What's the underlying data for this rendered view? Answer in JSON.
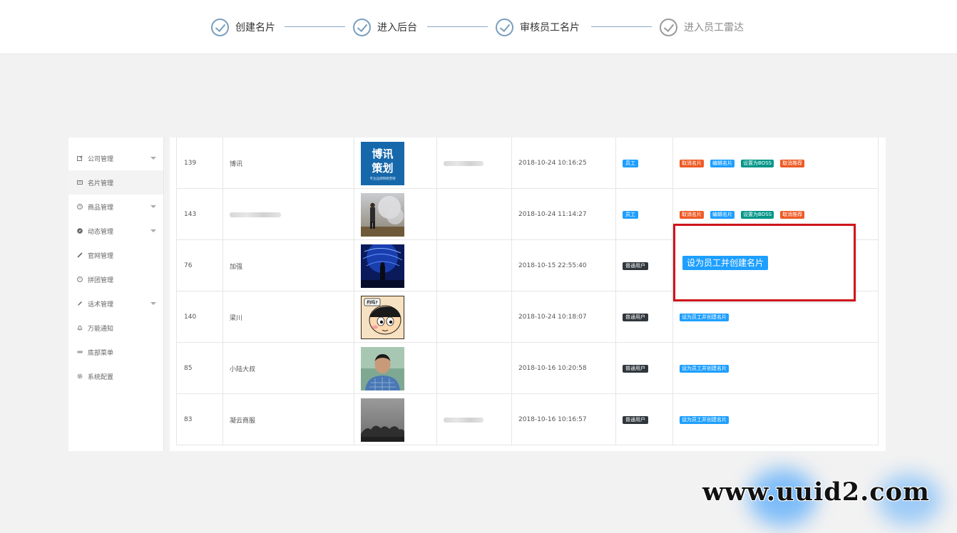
{
  "stepper": {
    "steps": [
      {
        "label": "创建名片",
        "state": "done"
      },
      {
        "label": "进入后台",
        "state": "done"
      },
      {
        "label": "审核员工名片",
        "state": "done"
      },
      {
        "label": "进入员工雷达",
        "state": "pending"
      }
    ]
  },
  "sidebar": {
    "items": [
      {
        "label": "公司管理",
        "icon": "edit-square-icon",
        "expandable": true
      },
      {
        "label": "名片管理",
        "icon": "card-icon",
        "expandable": false,
        "active": true
      },
      {
        "label": "商品管理",
        "icon": "clock-icon",
        "expandable": true
      },
      {
        "label": "动态管理",
        "icon": "compass-icon",
        "expandable": true
      },
      {
        "label": "官网管理",
        "icon": "link-icon",
        "expandable": false
      },
      {
        "label": "拼团管理",
        "icon": "circle-clock-icon",
        "expandable": false
      },
      {
        "label": "话术管理",
        "icon": "pencil-icon",
        "expandable": true
      },
      {
        "label": "万能通知",
        "icon": "bell-icon",
        "expandable": false
      },
      {
        "label": "底部菜单",
        "icon": "infinity-icon",
        "expandable": false
      },
      {
        "label": "系统配置",
        "icon": "gear-icon",
        "expandable": false
      }
    ]
  },
  "table": {
    "rows": [
      {
        "id": "139",
        "name": "博讯",
        "name_blurred": false,
        "avatar": "boxun-logo",
        "phone_blurred": true,
        "time": "2018-10-24 10:16:25",
        "role": "员工",
        "role_style": "blue",
        "actions": [
          {
            "label": "取消名片",
            "style": "orange"
          },
          {
            "label": "编辑名片",
            "style": "blue"
          },
          {
            "label": "设置为BOSS",
            "style": "teal"
          },
          {
            "label": "取消推荐",
            "style": "orange"
          }
        ]
      },
      {
        "id": "143",
        "name": "",
        "name_blurred": true,
        "avatar": "person-smoke",
        "phone_blurred": false,
        "time": "2018-10-24 11:14:27",
        "role": "员工",
        "role_style": "blue",
        "actions": [
          {
            "label": "取消名片",
            "style": "orange"
          },
          {
            "label": "编辑名片",
            "style": "blue"
          },
          {
            "label": "设置为BOSS",
            "style": "teal"
          },
          {
            "label": "取消推荐",
            "style": "orange"
          }
        ]
      },
      {
        "id": "76",
        "name": "加强",
        "name_blurred": false,
        "avatar": "blue-lights",
        "phone_blurred": false,
        "time": "2018-10-15 22:55:40",
        "role": "普通用户",
        "role_style": "dark",
        "actions": []
      },
      {
        "id": "140",
        "name": "梁川",
        "name_blurred": false,
        "avatar": "cartoon-boy",
        "phone_blurred": false,
        "time": "2018-10-24 10:18:07",
        "role": "普通用户",
        "role_style": "dark",
        "actions": [
          {
            "label": "设为员工并创建名片",
            "style": "blue"
          }
        ]
      },
      {
        "id": "85",
        "name": "小陆大叔",
        "name_blurred": false,
        "avatar": "man-portrait",
        "phone_blurred": false,
        "time": "2018-10-16 10:20:58",
        "role": "普通用户",
        "role_style": "dark",
        "actions": [
          {
            "label": "设为员工并创建名片",
            "style": "blue"
          }
        ]
      },
      {
        "id": "83",
        "name": "凝云商服",
        "name_blurred": false,
        "avatar": "foggy-trees",
        "phone_blurred": true,
        "time": "2018-10-16 10:16:57",
        "role": "普通用户",
        "role_style": "dark",
        "actions": [
          {
            "label": "设为员工并创建名片",
            "style": "blue"
          }
        ]
      }
    ]
  },
  "boxun_logo": {
    "line1": "博讯",
    "line2": "策划",
    "caption": "专注品牌网络营销"
  },
  "cartoon_badge": "约吗?",
  "callout": {
    "button_label": "设为员工并创建名片"
  },
  "watermark": {
    "text": "www.uuid2.com"
  },
  "colors": {
    "accent_blue": "#1e9fff",
    "danger_orange": "#ee5a24",
    "teal": "#009688",
    "dark_tag": "#2f363c",
    "callout_border": "#d0141b"
  }
}
